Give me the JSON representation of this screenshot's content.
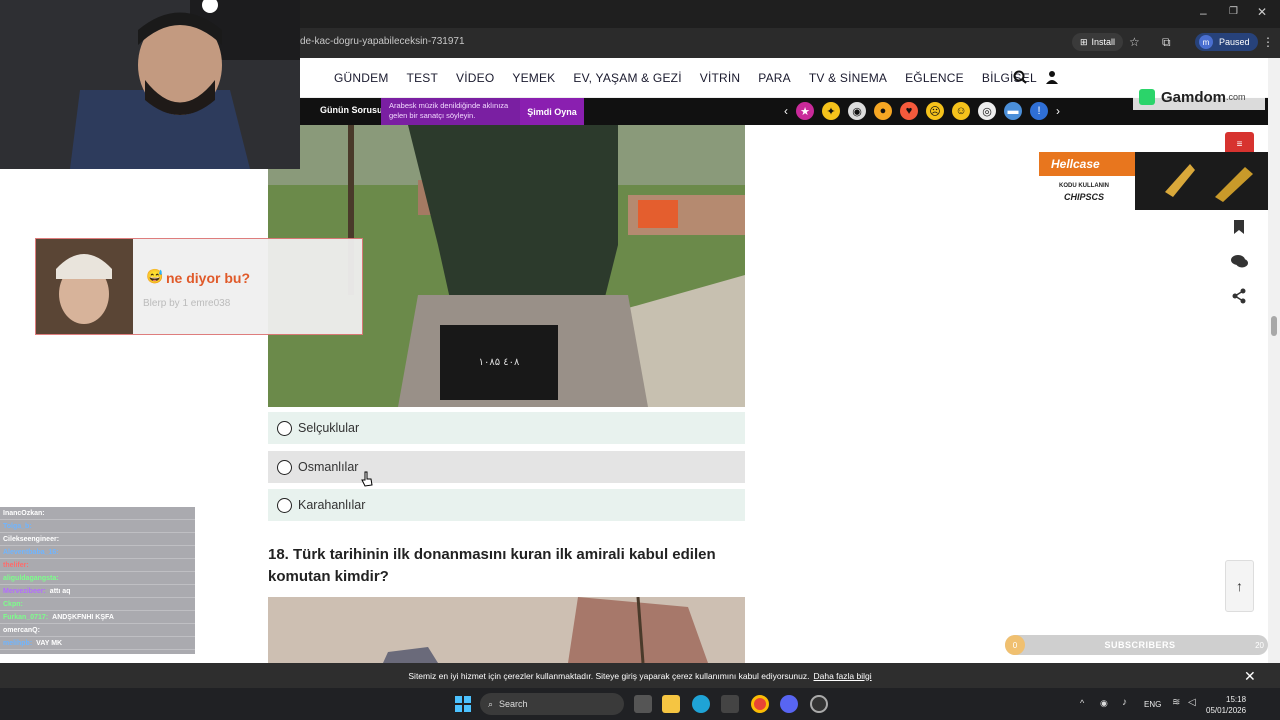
{
  "browser": {
    "url": "de-kac-dogru-yapabileceksin-731971",
    "install_label": "Install",
    "profile_initial": "m",
    "paused_label": "Paused"
  },
  "site": {
    "nav": [
      "GÜNDEM",
      "TEST",
      "VİDEO",
      "YEMEK",
      "EV, YAŞAM & GEZİ",
      "VİTRİN",
      "PARA",
      "TV & SİNEMA",
      "EĞLENCE",
      "BİLGİSEL"
    ],
    "strip": {
      "gunun_label": "Günün Sorusu",
      "question_text": "Arabesk müzik denildiğinde aklınıza gelen bir sanatçı söyleyin.",
      "play_label": "Şimdi Oyna"
    }
  },
  "gamdom": {
    "brand": "Gamdom",
    "suffix": ".com"
  },
  "quiz": {
    "options": [
      "Selçuklular",
      "Osmanlılar",
      "Karahanlılar"
    ],
    "question": "18. Türk tarihinin ilk donanmasını kuran ilk amirali kabul edilen komutan kimdir?"
  },
  "hellcase": {
    "brand": "Hellcase",
    "line1": "KODU KULLANIN",
    "code": "CHIPSCS"
  },
  "subscribers": {
    "left": "0",
    "label": "SUBSCRIBERS",
    "right": "20"
  },
  "cookie": {
    "text": "Sitemiz en iyi hizmet için çerezler kullanmaktadır. Siteye giriş yaparak çerez kullanımını kabul ediyorsunuz.",
    "link": "Daha fazla bilgi"
  },
  "taskbar": {
    "search_placeholder": "Search",
    "lang": "ENG",
    "time": "15:18",
    "date": "05/01/2026"
  },
  "alert": {
    "title": "ne diyor bu?",
    "subtitle": "Blerp by 1 emre038"
  },
  "chat": [
    {
      "user": "InancOzkan",
      "msg": "",
      "color": "#ffffff"
    },
    {
      "user": "Tolga_b",
      "msg": "",
      "color": "#6fb5ff"
    },
    {
      "user": "Cilekseengineer",
      "msg": "",
      "color": "#ffffff"
    },
    {
      "user": "Aleventbaba_16",
      "msg": "",
      "color": "#6fb5ff"
    },
    {
      "user": "thelifer",
      "msg": "",
      "color": "#ff6b6b"
    },
    {
      "user": "aliguldagangsta",
      "msg": "",
      "color": "#7cff8a"
    },
    {
      "user": "Mervezibeer",
      "msg": "attı aq",
      "color": "#b46bff"
    },
    {
      "user": "Ckpn",
      "msg": "",
      "color": "#7cff8a"
    },
    {
      "user": "Furkan_0717",
      "msg": "ANDŞKFNHI KŞFA",
      "color": "#7cff8a"
    },
    {
      "user": "omercanQ",
      "msg": "",
      "color": "#ffffff"
    },
    {
      "user": "melihpb",
      "msg": "VAY MK",
      "color": "#6fb5ff"
    }
  ]
}
